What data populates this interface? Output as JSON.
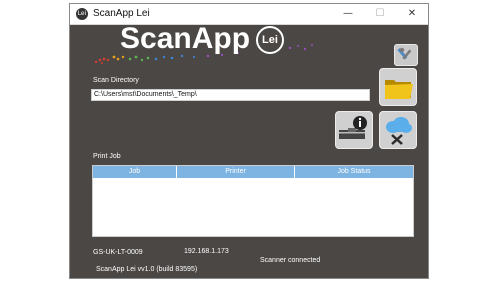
{
  "window": {
    "title": "ScanApp Lei",
    "app_icon_text": "Lei",
    "controls": {
      "minimize": "—",
      "maximize": "☐",
      "close": "✕"
    }
  },
  "logo": {
    "text": "ScanApp",
    "badge": "Lei"
  },
  "scan_directory": {
    "label": "Scan Directory",
    "value": "C:\\Users\\mst\\Documents\\_Temp\\"
  },
  "print_job": {
    "label": "Print Job",
    "columns": [
      "Job",
      "Printer",
      "Job Status"
    ],
    "rows": []
  },
  "status_bar": {
    "hostname": "GS-UK-LT-0009",
    "ip": "192.168.1.173",
    "scanner_status": "Scanner connected",
    "version": "ScanApp Lei vv1.0 (build 83595)"
  },
  "icons": {
    "settings": "wrench-screwdriver-icon",
    "folder": "folder-icon",
    "scanner": "scanner-info-icon",
    "cloud": "cloud-disconnected-icon"
  },
  "colors": {
    "window_bg": "#4a4745",
    "table_header": "#7eb4e2",
    "folder_yellow": "#e2b400",
    "cloud_blue": "#5aaeea"
  }
}
